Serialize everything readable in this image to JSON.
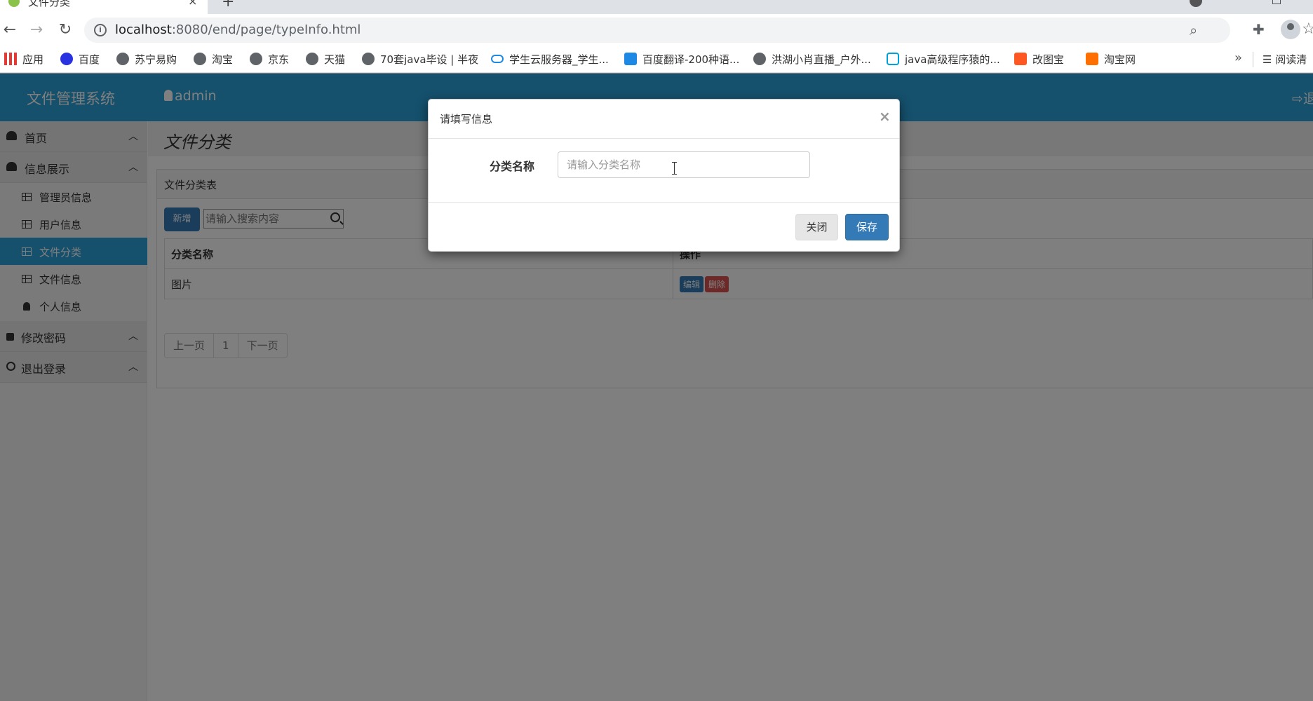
{
  "browser": {
    "tab_title": "文件分类",
    "url_host": "localhost",
    "url_path": ":8080/end/page/typeInfo.html",
    "bookmarks": [
      {
        "label": "应用",
        "icon": "apps-icon"
      },
      {
        "label": "百度",
        "icon": "baidu-icon"
      },
      {
        "label": "苏宁易购",
        "icon": "globe-icon"
      },
      {
        "label": "淘宝",
        "icon": "globe-icon"
      },
      {
        "label": "京东",
        "icon": "globe-icon"
      },
      {
        "label": "天猫",
        "icon": "globe-icon"
      },
      {
        "label": "70套java毕设 | 半夜",
        "icon": "globe-icon"
      },
      {
        "label": "学生云服务器_学生...",
        "icon": "cloud-icon"
      },
      {
        "label": "百度翻译-200种语...",
        "icon": "fanyi-icon"
      },
      {
        "label": "洪湖小肖直播_户外...",
        "icon": "bird-icon"
      },
      {
        "label": "java高级程序猿的...",
        "icon": "bilibili-icon"
      },
      {
        "label": "改图宝",
        "icon": "gaitubao-icon"
      },
      {
        "label": "淘宝网",
        "icon": "taobao-icon"
      }
    ],
    "more": "»",
    "reading_list": "阅读清"
  },
  "app": {
    "brand": "文件管理系统",
    "user": "admin",
    "logout_top": "退"
  },
  "sidebar": {
    "home": "首页",
    "info_display": "信息展示",
    "items": [
      {
        "label": "管理员信息"
      },
      {
        "label": "用户信息"
      },
      {
        "label": "文件分类"
      },
      {
        "label": "文件信息"
      },
      {
        "label": "个人信息"
      }
    ],
    "change_password": "修改密码",
    "logout": "退出登录"
  },
  "main": {
    "heading": "文件分类",
    "panel_title": "文件分类表",
    "add_label": "新增",
    "search_placeholder": "请输入搜索内容",
    "columns": [
      "分类名称",
      "操作"
    ],
    "rows": [
      {
        "name": "图片",
        "edit": "编辑",
        "delete": "删除"
      }
    ],
    "pager": {
      "prev": "上一页",
      "page": "1",
      "next": "下一页"
    }
  },
  "modal": {
    "title": "请填写信息",
    "close_symbol": "×",
    "field_label": "分类名称",
    "field_placeholder": "请输入分类名称",
    "cancel_label": "关闭",
    "save_label": "保存"
  },
  "colors": {
    "header": "#2ba1d9",
    "primary": "#337ab7",
    "danger": "#d9534f",
    "backdrop": "rgba(0,0,0,0.5)"
  }
}
